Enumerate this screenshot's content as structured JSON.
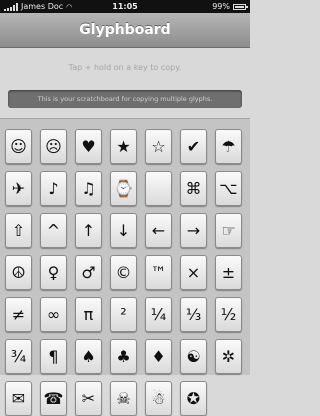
{
  "status_bar": {
    "carrier": "James Doc",
    "time": "11:05",
    "battery": "99%",
    "battery_level": 0.99
  },
  "navbar": {
    "title": "Glyphboard"
  },
  "hint_text": "Tap + hold on a key to copy.",
  "scratchpad_text": "This is your scratchboard for copying multiple glyphs.",
  "keys": [
    {
      "glyph": "☺",
      "name": "smiley"
    },
    {
      "glyph": "☹",
      "name": "frown"
    },
    {
      "glyph": "♥",
      "name": "heart"
    },
    {
      "glyph": "★",
      "name": "black-star"
    },
    {
      "glyph": "☆",
      "name": "white-star"
    },
    {
      "glyph": "✔",
      "name": "check"
    },
    {
      "glyph": "☂",
      "name": "umbrella"
    },
    {
      "glyph": "✈",
      "name": "airplane"
    },
    {
      "glyph": "♪",
      "name": "eighth-note"
    },
    {
      "glyph": "♫",
      "name": "beamed-notes"
    },
    {
      "glyph": "⌚",
      "name": "watch"
    },
    {
      "glyph": "",
      "name": "apple"
    },
    {
      "glyph": "⌘",
      "name": "command"
    },
    {
      "glyph": "⌥",
      "name": "option"
    },
    {
      "glyph": "⇧",
      "name": "shift"
    },
    {
      "glyph": "^",
      "name": "caret"
    },
    {
      "glyph": "↑",
      "name": "arrow-up"
    },
    {
      "glyph": "↓",
      "name": "arrow-down"
    },
    {
      "glyph": "←",
      "name": "arrow-left"
    },
    {
      "glyph": "→",
      "name": "arrow-right"
    },
    {
      "glyph": "☞",
      "name": "pointing-hand"
    },
    {
      "glyph": "☮",
      "name": "peace"
    },
    {
      "glyph": "♀",
      "name": "female"
    },
    {
      "glyph": "♂",
      "name": "male"
    },
    {
      "glyph": "©",
      "name": "copyright"
    },
    {
      "glyph": "™",
      "name": "trademark"
    },
    {
      "glyph": "×",
      "name": "multiply"
    },
    {
      "glyph": "±",
      "name": "plus-minus"
    },
    {
      "glyph": "≠",
      "name": "not-equal"
    },
    {
      "glyph": "∞",
      "name": "infinity"
    },
    {
      "glyph": "π",
      "name": "pi"
    },
    {
      "glyph": "²",
      "name": "superscript-two"
    },
    {
      "glyph": "¼",
      "name": "one-quarter"
    },
    {
      "glyph": "⅓",
      "name": "one-third"
    },
    {
      "glyph": "½",
      "name": "one-half"
    },
    {
      "glyph": "¾",
      "name": "three-quarters"
    },
    {
      "glyph": "¶",
      "name": "pilcrow"
    },
    {
      "glyph": "♠",
      "name": "spade"
    },
    {
      "glyph": "♣",
      "name": "club"
    },
    {
      "glyph": "♦",
      "name": "diamond"
    },
    {
      "glyph": "☯",
      "name": "yin-yang"
    },
    {
      "glyph": "✲",
      "name": "asterisk-star"
    },
    {
      "glyph": "✉",
      "name": "envelope"
    },
    {
      "glyph": "☎",
      "name": "telephone"
    },
    {
      "glyph": "✂",
      "name": "scissors"
    },
    {
      "glyph": "☠",
      "name": "skull"
    },
    {
      "glyph": "☃",
      "name": "snowman"
    },
    {
      "glyph": "✪",
      "name": "circled-star"
    }
  ]
}
